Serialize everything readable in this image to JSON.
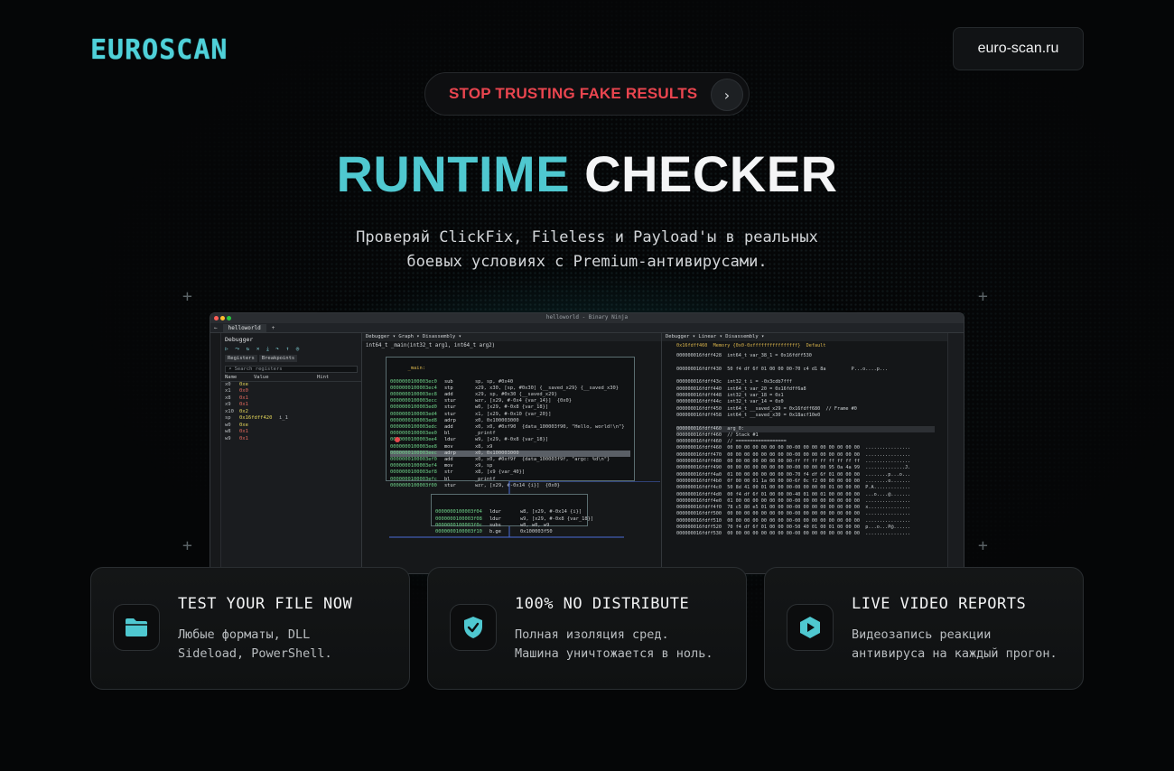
{
  "brand": {
    "logo": "EUROSCAN",
    "domain": "euro-scan.ru",
    "accent": "#4fc8d0"
  },
  "banner": {
    "text": "STOP TRUSTING FAKE RESULTS",
    "arrow": "›",
    "color": "#e9454f"
  },
  "hero": {
    "title_part1": "RUNTIME",
    "title_part2": "CHECKER",
    "subtitle_line1": "Проверяй ClickFix, Fileless и Payload'ы в реальных",
    "subtitle_line2": "боевых условиях с Premium-антивирусами."
  },
  "app": {
    "window_title": "helloworld - Binary Ninja",
    "tab": "helloworld",
    "left_pane": {
      "title": "Debugger",
      "tabs": [
        "Registers",
        "Breakpoints"
      ],
      "search_placeholder": "Search registers",
      "columns": [
        "Name",
        "Value",
        "Hint"
      ],
      "registers": [
        {
          "name": "x0",
          "value": "0xe",
          "hint": ""
        },
        {
          "name": "x1",
          "value": "0x0",
          "hint": ""
        },
        {
          "name": "x8",
          "value": "0x1",
          "hint": ""
        },
        {
          "name": "x9",
          "value": "0x1",
          "hint": ""
        },
        {
          "name": "x10",
          "value": "0x2",
          "hint": ""
        },
        {
          "name": "sp",
          "value": "0x16fdff420",
          "hint": "i_1"
        },
        {
          "name": "w0",
          "value": "0xe",
          "hint": ""
        },
        {
          "name": "w8",
          "value": "0x1",
          "hint": ""
        },
        {
          "name": "w9",
          "value": "0x1",
          "hint": ""
        }
      ]
    },
    "center_pane": {
      "header": "Debugger ▾   Graph ▾   Disassembly ▾",
      "signature": "int64_t _main(int32_t arg1, int64_t arg2)",
      "main_block_label": "_main:",
      "main_block": [
        {
          "addr": "0000000100003ec0",
          "mn": "sub",
          "op": "sp, sp, #0x40"
        },
        {
          "addr": "0000000100003ec4",
          "mn": "stp",
          "op": "x29, x30, [sp, #0x30] {__saved_x29} {__saved_x30}"
        },
        {
          "addr": "0000000100003ec8",
          "mn": "add",
          "op": "x29, sp, #0x30 {__saved_x29}"
        },
        {
          "addr": "0000000100003ecc",
          "mn": "stur",
          "op": "wzr, [x29, #-0x4 {var_14}]  {0x0}"
        },
        {
          "addr": "0000000100003ed0",
          "mn": "stur",
          "op": "w0, [x29, #-0x8 {var_18}]"
        },
        {
          "addr": "0000000100003ed4",
          "mn": "stur",
          "op": "x1, [x29, #-0x10 {var_20}]"
        },
        {
          "addr": "0000000100003ed8",
          "mn": "adrp",
          "op": "x0, 0x100003000"
        },
        {
          "addr": "0000000100003edc",
          "mn": "add",
          "op": "x0, x0, #0xf90  {data_100003f90, \"Hello, world!\\n\"}"
        },
        {
          "addr": "0000000100003ee0",
          "mn": "bl",
          "op": "_printf"
        },
        {
          "addr": "0000000100003ee4",
          "mn": "ldur",
          "op": "w9, [x29, #-0x8 {var_18}]"
        },
        {
          "addr": "0000000100003ee8",
          "mn": "mov",
          "op": "x8, x9"
        },
        {
          "addr": "0000000100003eec",
          "mn": "adrp",
          "op": "x0, 0x100003000"
        },
        {
          "addr": "0000000100003ef0",
          "mn": "add",
          "op": "x0, x0, #0xf9f  {data_100003f9f, \"argc: %d\\n\"}"
        },
        {
          "addr": "0000000100003ef4",
          "mn": "mov",
          "op": "x9, sp"
        },
        {
          "addr": "0000000100003ef8",
          "mn": "str",
          "op": "x8, [x9 {var_40}]"
        },
        {
          "addr": "0000000100003efc",
          "mn": "bl",
          "op": "_printf"
        },
        {
          "addr": "0000000100003f00",
          "mn": "stur",
          "op": "wzr, [x29, #-0x14 {i}]  {0x0}"
        }
      ],
      "highlight_index": 11,
      "small_block": [
        {
          "addr": "0000000100003f04",
          "mn": "ldur",
          "op": "w8, [x29, #-0x14 {i}]"
        },
        {
          "addr": "0000000100003f08",
          "mn": "ldur",
          "op": "w9, [x29, #-0x8 {var_18}]"
        },
        {
          "addr": "0000000100003f0c",
          "mn": "subs",
          "op": "w8, w8, w9"
        },
        {
          "addr": "0000000100003f10",
          "mn": "b.ge",
          "op": "0x100003f50"
        }
      ]
    },
    "right_pane": {
      "header": "Debugger ▾   Linear ▾   Disassembly ▾",
      "memory_line": "0x16fdff460  Memory {0x0-0xffffffffffffffff}  Default",
      "lines": [
        "000000016fdff428  int64_t var_38_1 = 0x16fdff530",
        "",
        "000000016fdff430  50 f4 df 6f 01 00 00 00-70 c4 d1 8a         P...o....p...",
        "",
        "000000016fdff43c  int32_t i = -0x3cdb7fff",
        "000000016fdff440  int64_t var_20 = 0x16fdff6a8",
        "000000016fdff448  int32_t var_18 = 0x1",
        "000000016fdff44c  int32_t var_14 = 0x0",
        "000000016fdff450  int64_t __saved_x29 = 0x16fdff680  // Frame #0",
        "000000016fdff458  int64_t __saved_x30 = 0x18acf10e0",
        "",
        "000000016fdff460  arg_0:",
        "000000016fdff460  // Stack #1",
        "000000016fdff460  // ==================",
        "000000016fdff460  00 00 00 00 00 00 00 00-00 00 00 00 00 00 00 00  ................",
        "000000016fdff470  00 00 00 00 00 00 00 00-00 00 00 00 00 00 00 00  ................",
        "000000016fdff480  00 00 00 00 00 00 00 00-ff ff ff ff ff ff ff ff  ................",
        "000000016fdff490  00 00 00 00 00 00 00 00-00 00 00 00 95 0a 4a 99  ..............J.",
        "000000016fdff4a0  01 00 00 00 00 00 00 00-70 f4 df 6f 01 00 00 00  ........p...o...",
        "000000016fdff4b0  0f 00 00 01 1a 00 00 00-6f 0c f2 00 00 00 00 00  ........o.......",
        "000000016fdff4c0  50 8d 41 00 01 00 00 00-00 00 00 00 01 00 00 00  P.A.............",
        "000000016fdff4d0  00 f4 df 6f 01 00 00 00-40 01 00 01 00 00 00 00  ...o....@.......",
        "000000016fdff4e0  01 00 00 00 00 00 00 00-00 00 00 00 00 00 00 00  ................",
        "000000016fdff4f0  78 c5 80 e5 01 00 00 00-00 00 00 00 00 00 00 00  x...............",
        "000000016fdff500  00 00 00 00 00 00 00 00-00 00 00 00 00 00 00 00  ................",
        "000000016fdff510  00 00 00 00 00 00 00 00-00 00 00 00 00 00 00 00  ................",
        "000000016fdff520  70 f4 df 6f 01 00 00 00-50 40 01 00 01 00 00 00  p...o...P@......",
        "000000016fdff530  00 00 00 00 00 00 00 00-00 00 00 00 00 00 00 00  ................"
      ]
    }
  },
  "cards": [
    {
      "icon": "folder-icon",
      "title": "TEST YOUR FILE NOW",
      "line1": "Любые форматы, DLL",
      "line2": "Sideload, PowerShell."
    },
    {
      "icon": "shield-check-icon",
      "title": "100% NO DISTRIBUTE",
      "line1": "Полная изоляция сред.",
      "line2": "Машина уничтожается в ноль."
    },
    {
      "icon": "play-icon",
      "title": "LIVE VIDEO REPORTS",
      "line1": "Видеозапись реакции",
      "line2": "антивируса на каждый прогон."
    }
  ]
}
